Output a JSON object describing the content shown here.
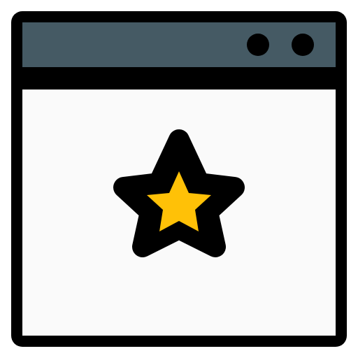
{
  "icon": {
    "name": "browser-window-star-icon",
    "colors": {
      "outline": "#000000",
      "title_bar": "#455A64",
      "content": "#FAFAFA",
      "star": "#FFC107"
    },
    "title_bar_dots": 2
  }
}
